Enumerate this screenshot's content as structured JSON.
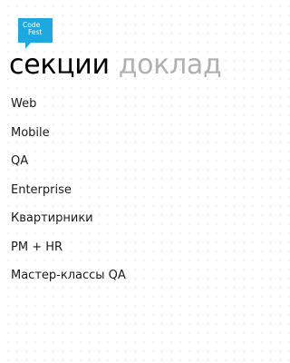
{
  "app": {
    "logo_line1": "Code",
    "logo_line2": "Fest",
    "brand_color": "#1da8e0"
  },
  "pivot": {
    "active_label": "секции",
    "inactive_label": "доклад"
  },
  "sections": [
    {
      "label": "Web"
    },
    {
      "label": "Mobile"
    },
    {
      "label": "QA"
    },
    {
      "label": "Enterprise"
    },
    {
      "label": "Квартирники"
    },
    {
      "label": "PM + HR"
    },
    {
      "label": "Мастер-классы QA"
    }
  ]
}
